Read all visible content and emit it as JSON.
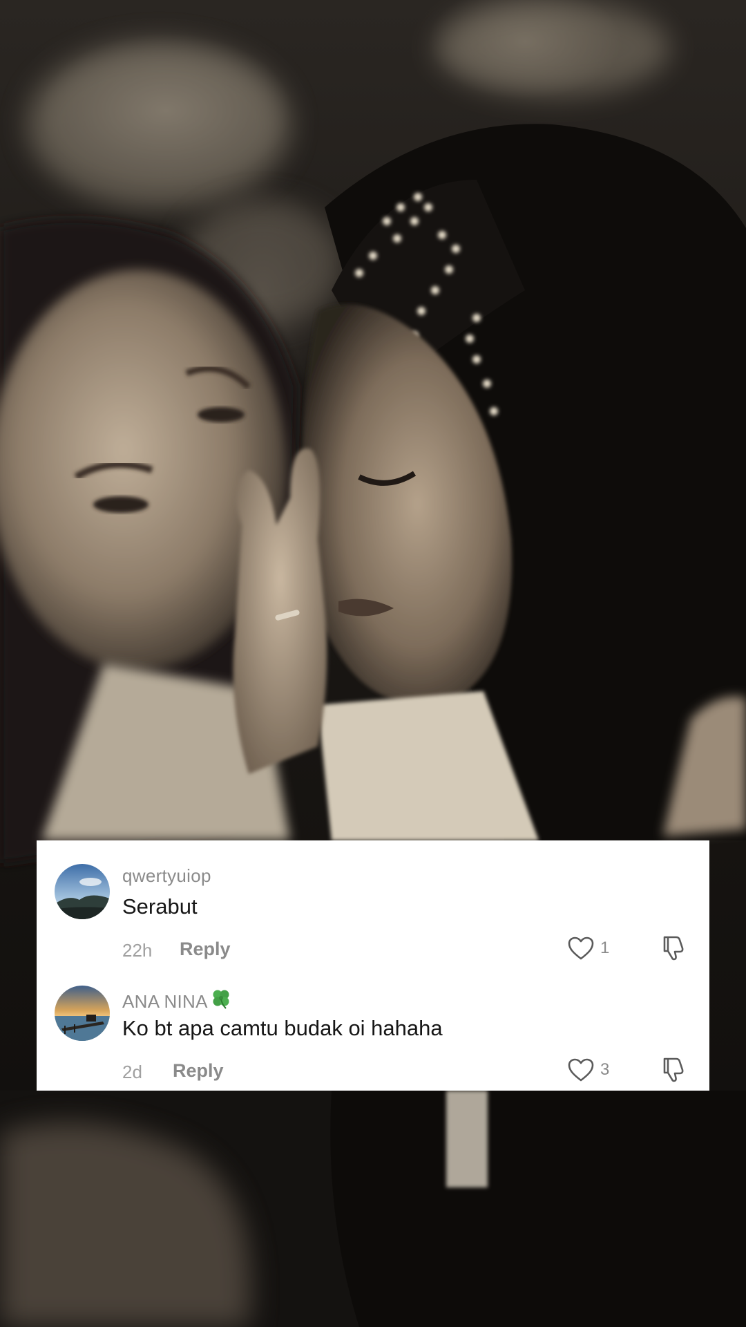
{
  "comments": [
    {
      "username": "qwertyuiop",
      "text": "Serabut",
      "age": "22h",
      "reply_label": "Reply",
      "likes": "1",
      "avatar_icon": "landscape-mountain-avatar"
    },
    {
      "username": "ANA NINA",
      "username_emoji": "four-leaf-clover-icon",
      "text": "Ko bt apa camtu budak oi hahaha",
      "age": "2d",
      "reply_label": "Reply",
      "likes": "3",
      "avatar_icon": "sunset-pier-avatar"
    }
  ],
  "colors": {
    "card_bg": "#ffffff",
    "username": "#8a8a8a",
    "comment_text": "#161616",
    "meta": "#a0a0a0",
    "photo_tone": "sepia"
  }
}
